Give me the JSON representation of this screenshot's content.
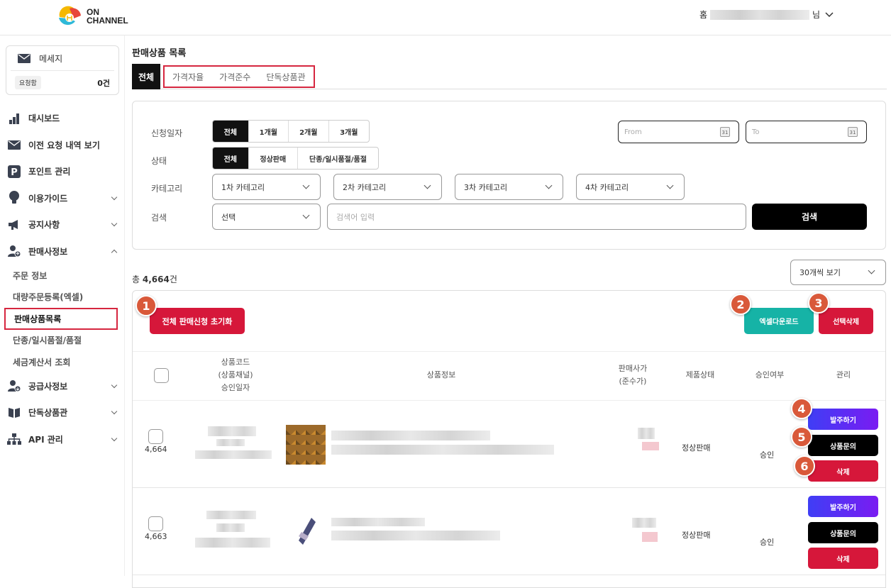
{
  "header": {
    "logo_line1": "ON",
    "logo_line2": "CHANNEL",
    "home": "홈",
    "user_suffix": "님"
  },
  "sidebar": {
    "message_title": "메세지",
    "request_label": "요청함",
    "request_count": "0건",
    "menu": [
      {
        "label": "대시보드",
        "icon": "bar-chart-icon"
      },
      {
        "label": "이전 요청 내역 보기",
        "icon": "mail-icon"
      },
      {
        "label": "포인트 관리",
        "icon": "p-icon"
      },
      {
        "label": "이용가이드",
        "icon": "bulb-icon"
      },
      {
        "label": "공지사항",
        "icon": "megaphone-icon"
      },
      {
        "label": "판매사정보",
        "icon": "user-icon"
      }
    ],
    "sub_items": [
      "주문 정보",
      "대량주문등록(엑셀)",
      "판매상품목록",
      "단종/일시품절/품절",
      "세금계산서 조회"
    ],
    "menu_after": [
      {
        "label": "공급사정보",
        "icon": "user-down-icon"
      },
      {
        "label": "단독상품관",
        "icon": "book-icon"
      },
      {
        "label": "API 관리",
        "icon": "network-icon"
      }
    ]
  },
  "main": {
    "title": "판매상품 목록",
    "tabs": [
      "전체",
      "가격자율",
      "가격준수",
      "단독상품관"
    ],
    "filters": {
      "date_label": "신청일자",
      "date_options": [
        "전체",
        "1개월",
        "2개월",
        "3개월"
      ],
      "from_placeholder": "From",
      "to_placeholder": "To",
      "status_label": "상태",
      "status_options": [
        "전체",
        "정상판매",
        "단종/일시품절/품절"
      ],
      "category_label": "카테고리",
      "categories": [
        "1차 카테고리",
        "2차 카테고리",
        "3차 카테고리",
        "4차 카테고리"
      ],
      "search_label": "검색",
      "search_select": "선택",
      "search_placeholder": "검색어 입력",
      "search_button": "검색"
    },
    "total_prefix": "총 ",
    "total_count": "4,664",
    "total_suffix": "건",
    "per_page": "30개씩 보기",
    "reset_button": "전체 판매신청 초기화",
    "excel_button": "엑셀다운로드",
    "delete_selected_button": "선택삭제",
    "columns": {
      "code1": "상품코드",
      "code2": "(상품채널)",
      "code3": "승인일자",
      "info": "상품정보",
      "price1": "판매사가",
      "price2": "(준수가)",
      "status": "제품상태",
      "approval": "승인여부",
      "manage": "관리"
    },
    "rows": [
      {
        "no": "4,664",
        "status": "정상판매",
        "approval": "승인",
        "order_btn": "발주하기",
        "inquiry_btn": "상품문의",
        "delete_btn": "삭제"
      },
      {
        "no": "4,663",
        "status": "정상판매",
        "approval": "승인",
        "order_btn": "발주하기",
        "inquiry_btn": "상품문의",
        "delete_btn": "삭제"
      }
    ],
    "badges": [
      "1",
      "2",
      "3",
      "4",
      "5",
      "6"
    ]
  }
}
